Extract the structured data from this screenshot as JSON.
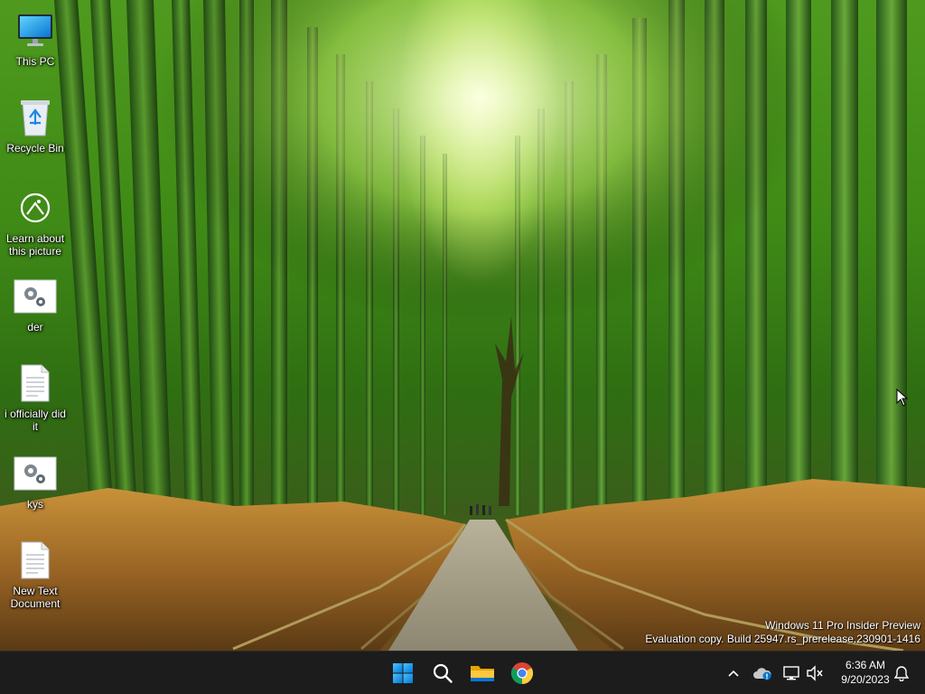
{
  "desktop": {
    "icons": [
      {
        "label": "This PC",
        "icon": "monitor-icon"
      },
      {
        "label": "Recycle Bin",
        "icon": "recycle-bin-icon"
      },
      {
        "label": "Learn about this picture",
        "icon": "learn-about-picture-icon"
      },
      {
        "label": "der",
        "icon": "settings-gears-icon"
      },
      {
        "label": "i officially did it",
        "icon": "text-document-icon"
      },
      {
        "label": "kys",
        "icon": "settings-gears-icon"
      },
      {
        "label": "New Text Document",
        "icon": "text-document-icon"
      }
    ],
    "watermark": {
      "line1": "Windows 11 Pro Insider Preview",
      "line2": "Evaluation copy. Build 25947.rs_prerelease.230901-1416"
    }
  },
  "taskbar": {
    "apps": [
      {
        "name": "start",
        "icon": "windows-logo-icon"
      },
      {
        "name": "search",
        "icon": "search-icon"
      },
      {
        "name": "file-explorer",
        "icon": "folder-icon"
      },
      {
        "name": "chrome",
        "icon": "chrome-icon"
      }
    ],
    "tray": [
      {
        "name": "show-hidden-icons",
        "icon": "chevron-up-icon"
      },
      {
        "name": "onedrive",
        "icon": "cloud-icon"
      },
      {
        "name": "network",
        "icon": "network-monitor-icon"
      },
      {
        "name": "volume",
        "icon": "speaker-muted-icon"
      }
    ],
    "clock": {
      "time": "6:36 AM",
      "date": "9/20/2023"
    },
    "notifications_icon": "bell-icon"
  },
  "colors": {
    "taskbar_bg": "#1c1c1c",
    "accent": "#0078d4"
  }
}
